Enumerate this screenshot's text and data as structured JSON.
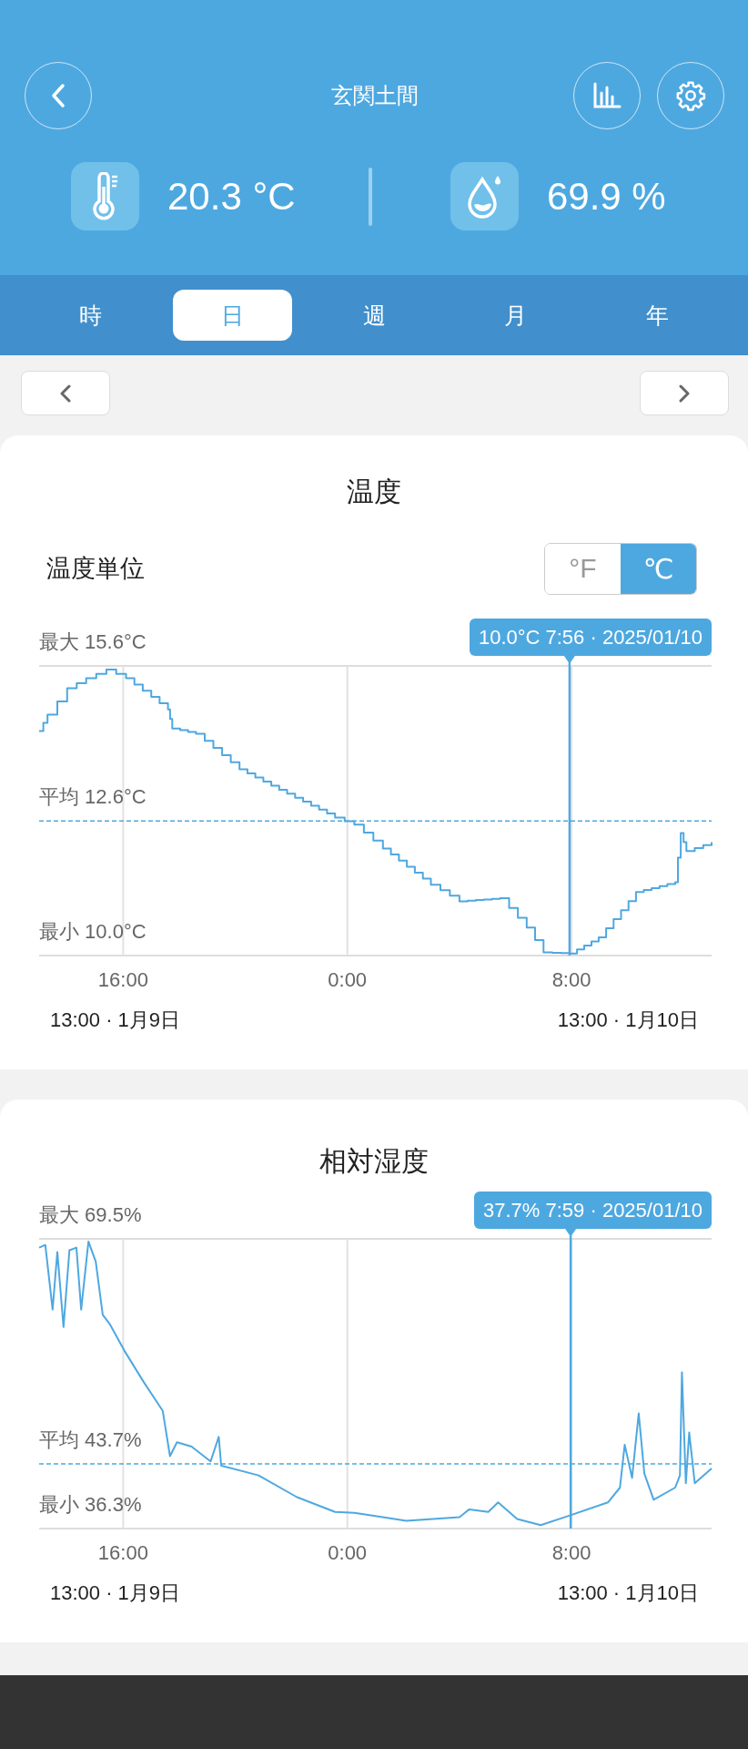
{
  "header": {
    "title": "玄関土間",
    "readings": [
      {
        "kind": "temperature",
        "value": "20.3 °C"
      },
      {
        "kind": "humidity",
        "value": "69.9 %"
      }
    ]
  },
  "tabs": [
    {
      "label": "時",
      "selected": false
    },
    {
      "label": "日",
      "selected": true
    },
    {
      "label": "週",
      "selected": false
    },
    {
      "label": "月",
      "selected": false
    },
    {
      "label": "年",
      "selected": false
    }
  ],
  "charts": [
    {
      "kind": "temperature",
      "title": "温度",
      "unit_setting": {
        "label": "温度単位",
        "options": [
          {
            "label": "°F",
            "selected": false
          },
          {
            "label": "℃",
            "selected": true
          }
        ]
      },
      "tooltip": "10.0°C 7:56 · 2025/01/10",
      "max_label": "最大 15.6°C",
      "average_label": "平均 12.6°C",
      "min_label": "最小 10.0°C",
      "time_labels": [
        "16:00",
        "0:00",
        "8:00"
      ],
      "range_start": "13:00 · 1月9日",
      "range_end": "13:00 · 1月10日"
    },
    {
      "kind": "humidity",
      "title": "相対湿度",
      "tooltip": "37.7% 7:59 · 2025/01/10",
      "max_label": "最大 69.5%",
      "average_label": "平均 43.7%",
      "min_label": "最小 36.3%",
      "time_labels": [
        "16:00",
        "0:00",
        "8:00"
      ],
      "range_start": "13:00 · 1月9日",
      "range_end": "13:00 · 1月10日"
    }
  ]
}
